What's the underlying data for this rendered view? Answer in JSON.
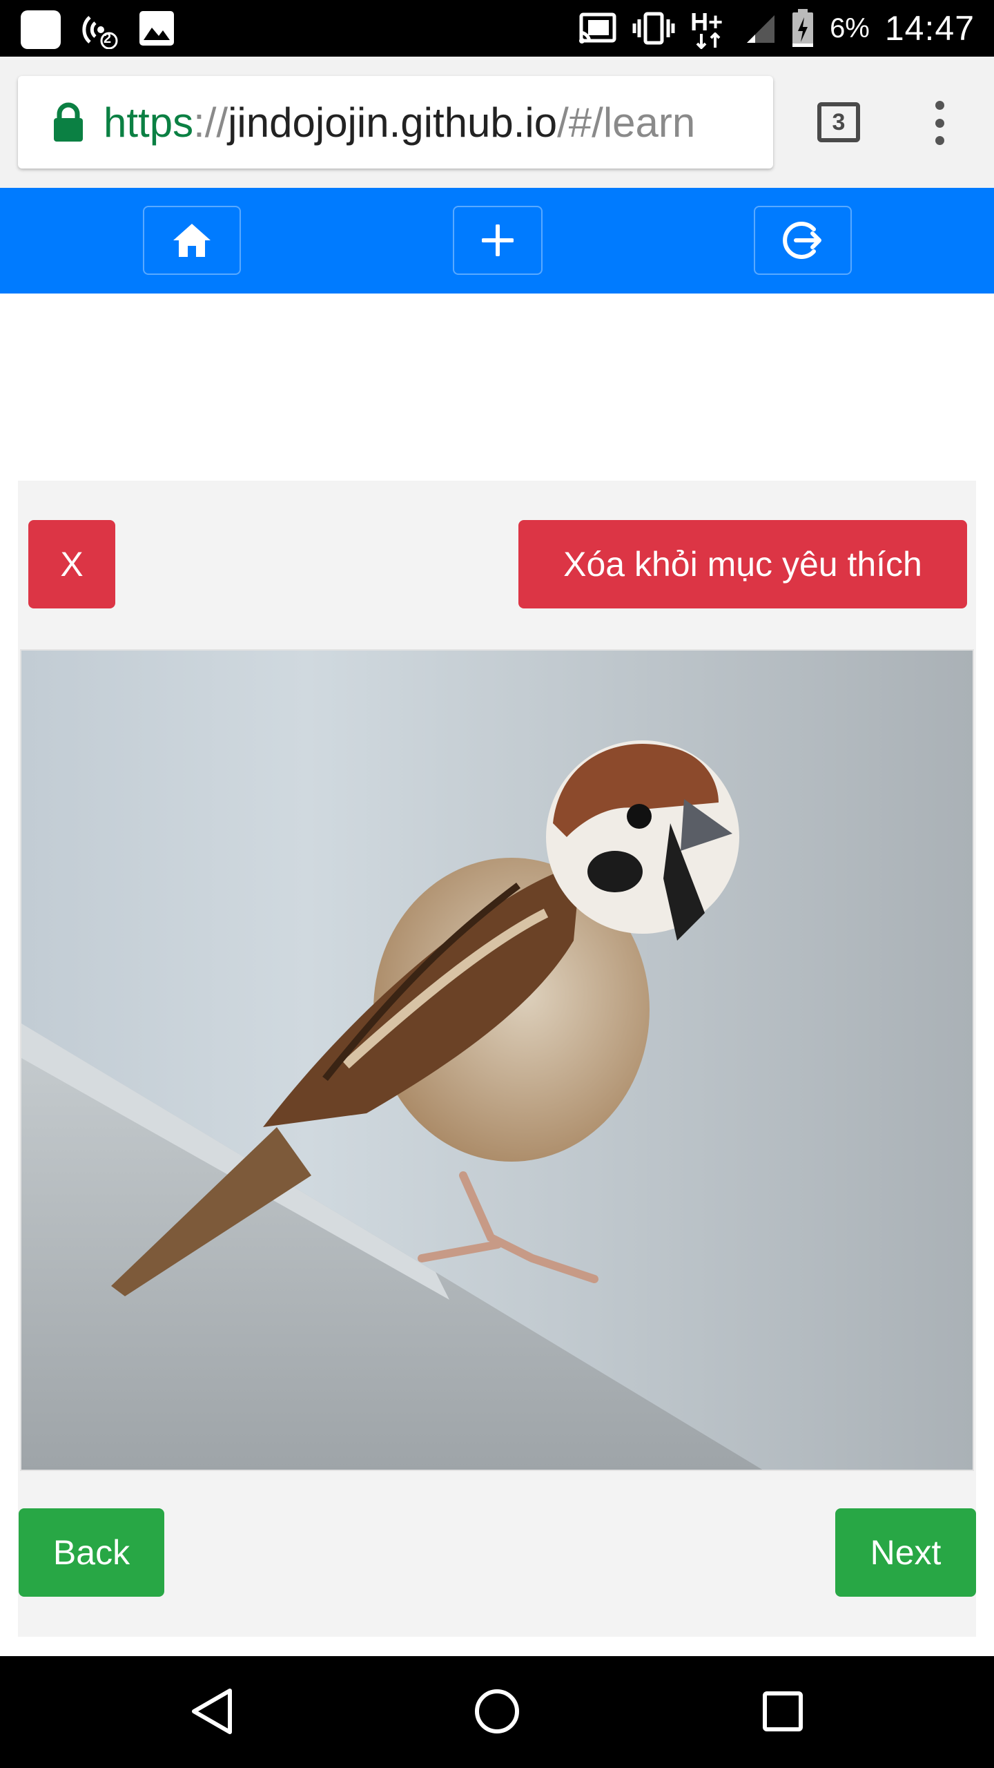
{
  "status_bar": {
    "battery_percent": "6%",
    "time": "14:47",
    "network": "H+",
    "hotspot_count": "2"
  },
  "browser": {
    "url_scheme": "https",
    "url_separator": "://",
    "url_host": "jindojojin.github.io",
    "url_path": "/#/learn",
    "tab_count": "3"
  },
  "navbar": {
    "color": "#007bff",
    "buttons": [
      "home-icon",
      "plus-icon",
      "logout-icon"
    ]
  },
  "card": {
    "close_label": "X",
    "remove_favorite_label": "Xóa khỏi mục yêu thích",
    "back_label": "Back",
    "next_label": "Next",
    "colors": {
      "danger": "#dc3545",
      "success": "#28a745"
    }
  }
}
